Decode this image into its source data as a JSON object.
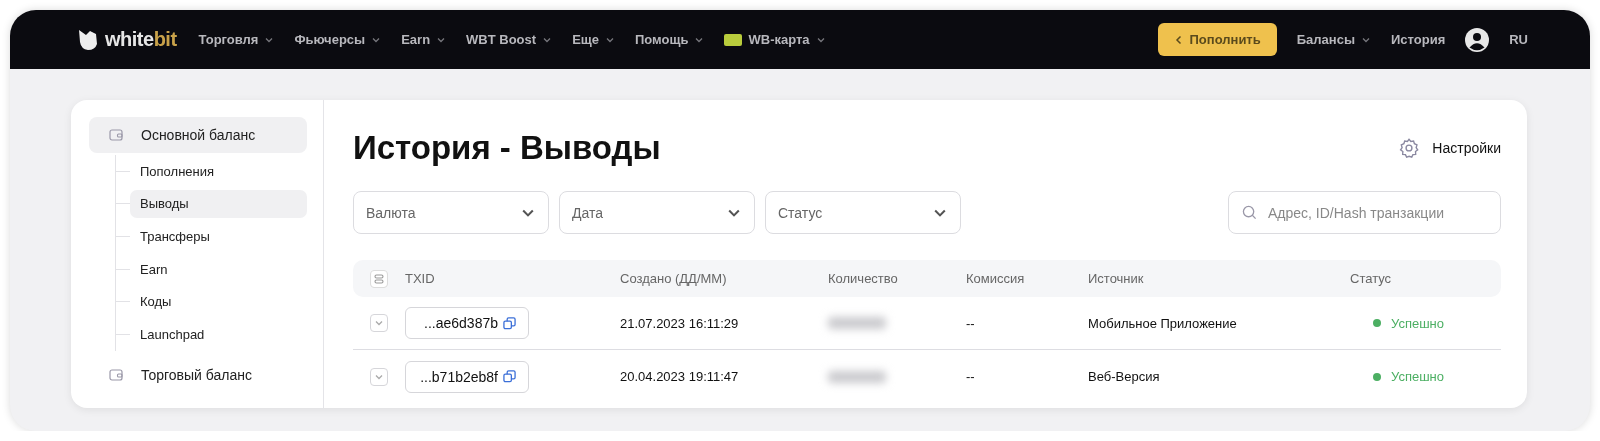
{
  "header": {
    "logo": {
      "main": "white",
      "accent": "bit"
    },
    "nav": [
      {
        "label": "Торговля",
        "dropdown": true,
        "kind": "text"
      },
      {
        "label": "Фьючерсы",
        "dropdown": true,
        "kind": "text"
      },
      {
        "label": "Earn",
        "dropdown": true,
        "kind": "text"
      },
      {
        "label": "WBT Boost",
        "dropdown": true,
        "kind": "text"
      },
      {
        "label": "Еще",
        "dropdown": true,
        "kind": "text"
      },
      {
        "label": "Помощь",
        "dropdown": true,
        "kind": "text"
      },
      {
        "label": "WB-карта",
        "dropdown": true,
        "kind": "card"
      }
    ],
    "deposit_button": "Пополнить",
    "right_nav": [
      {
        "label": "Балансы",
        "dropdown": true
      },
      {
        "label": "История",
        "dropdown": false
      }
    ],
    "language": "RU"
  },
  "sidebar": {
    "groups": [
      {
        "label": "Основной баланс",
        "selected": true,
        "children": [
          {
            "label": "Пополнения",
            "selected": false
          },
          {
            "label": "Выводы",
            "selected": true
          },
          {
            "label": "Трансферы",
            "selected": false
          },
          {
            "label": "Earn",
            "selected": false
          },
          {
            "label": "Коды",
            "selected": false
          },
          {
            "label": "Launchpad",
            "selected": false
          }
        ]
      },
      {
        "label": "Торговый баланс",
        "selected": false
      }
    ]
  },
  "page": {
    "title": "История - Выводы",
    "settings": "Настройки",
    "filters": [
      {
        "placeholder": "Валюта"
      },
      {
        "placeholder": "Дата"
      },
      {
        "placeholder": "Статус"
      }
    ],
    "search": {
      "placeholder": "Адрес, ID/Hash транзакции"
    }
  },
  "table": {
    "columns": [
      "TXID",
      "Создано (ДД/ММ)",
      "Количество",
      "Комиссия",
      "Источник",
      "Статус"
    ],
    "rows": [
      {
        "txid": "...ae6d387b",
        "created": "21.07.2023 16:11:29",
        "commission": "--",
        "source": "Мобильное Приложение",
        "status": "Успешно",
        "color": "#4caf63"
      },
      {
        "txid": "...b71b2eb8f",
        "created": "20.04.2023 19:11:47",
        "commission": "--",
        "source": "Веб-Версия",
        "status": "Успешно",
        "color": "#4caf63"
      }
    ]
  }
}
